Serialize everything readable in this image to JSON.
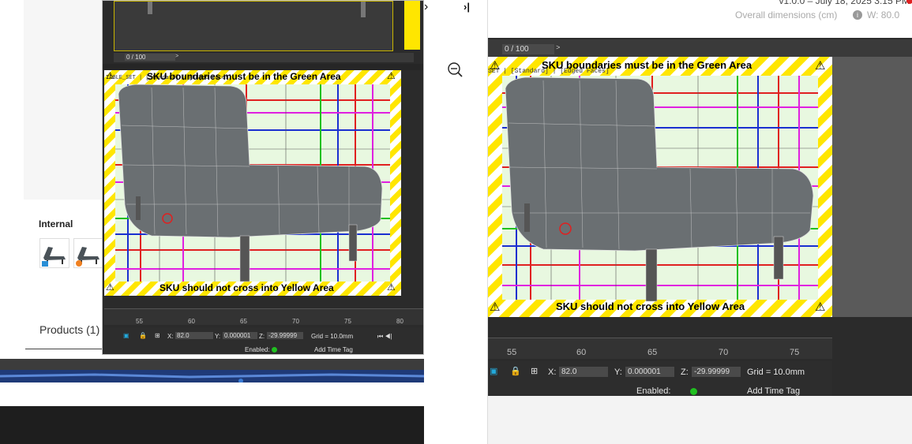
{
  "left": {
    "internal_label": "Internal",
    "products_tab": "Products (1)"
  },
  "preview_small": {
    "frame_counter": "0 / 100",
    "set_label": "TABLE_SET | [Standard] | [Edged Faces]",
    "top_warning": "SKU boundaries must be in the Green Area",
    "bottom_warning": "SKU should not cross into Yellow Area",
    "ruler_ticks": [
      "55",
      "60",
      "65",
      "70",
      "75",
      "80"
    ],
    "x_label": "X:",
    "x_value": "82.0",
    "y_label": "Y:",
    "y_value": "0.000001",
    "z_label": "Z:",
    "z_value": "-29.99999",
    "grid": "Grid = 10.0mm",
    "enabled": "Enabled:",
    "add_time_tag": "Add Time Tag"
  },
  "nav": {
    "next_icon": "›",
    "last_icon": "›|",
    "zoom_icon": "zoom-out"
  },
  "preview_large": {
    "version": "v1.0.0 – July 18, 2025 3:15 PM",
    "dims_label": "Overall dimensions (cm)",
    "width_label": "W: 80.0",
    "frame_counter": "0 / 100",
    "set_label": "SET | [Standard] | [Edged Faces]",
    "top_warning": "SKU boundaries must be in the Green Area",
    "bottom_warning": "SKU should not cross into Yellow Area",
    "ruler_ticks": [
      "55",
      "60",
      "65",
      "70",
      "75"
    ],
    "x_label": "X:",
    "x_value": "82.0",
    "y_label": "Y:",
    "y_value": "0.000001",
    "z_label": "Z:",
    "z_value": "-29.99999",
    "grid": "Grid = 10.0mm",
    "enabled": "Enabled:",
    "add_time_tag": "Add Time Tag"
  },
  "colors": {
    "warning_yellow": "#ffe600",
    "green_area": "#e8f8e0",
    "viewport_bg": "#3a3a3a",
    "grid_red": "#e02020",
    "grid_blue": "#1a2fd0",
    "grid_magenta": "#e020e0",
    "grid_green": "#20c020"
  }
}
